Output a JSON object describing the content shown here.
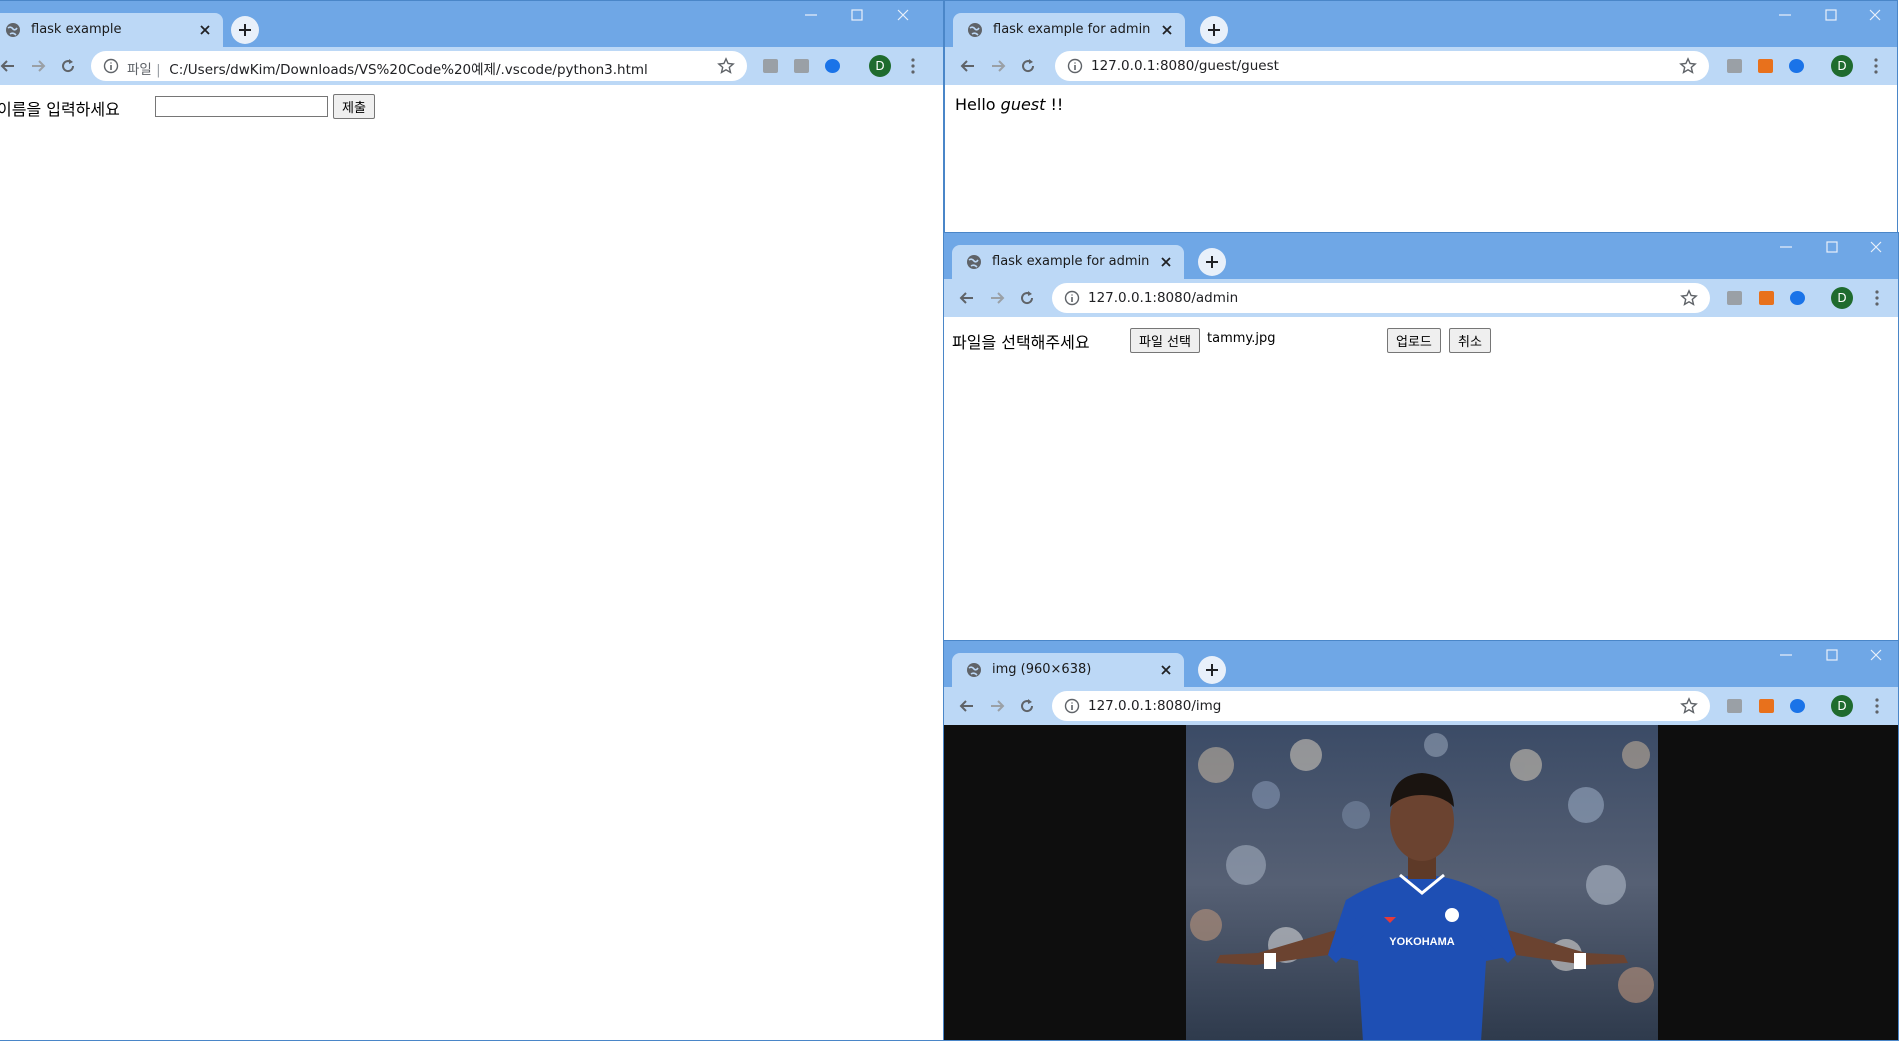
{
  "windows": {
    "left": {
      "tab_title": "flask example",
      "address_prefix": "파일",
      "address": "C:/Users/dwKim/Downloads/VS%20Code%20예제/.vscode/python3.html",
      "avatar_letter": "D",
      "page": {
        "name_label": "이름을 입력하세요",
        "name_input_value": "",
        "submit_label": "제출"
      }
    },
    "guest": {
      "tab_title": "flask example for admin",
      "address": "127.0.0.1:8080/guest/guest",
      "avatar_letter": "D",
      "page": {
        "hello": "Hello",
        "name": "guest",
        "suffix": "!!"
      }
    },
    "admin": {
      "tab_title": "flask example for admin",
      "address": "127.0.0.1:8080/admin",
      "avatar_letter": "D",
      "page": {
        "file_label": "파일을 선택해주세요",
        "choose_file_label": "파일 선택",
        "file_name": "tammy.jpg",
        "upload_label": "업로드",
        "cancel_label": "취소"
      }
    },
    "img": {
      "tab_title": "img (960×638)",
      "address": "127.0.0.1:8080/img",
      "avatar_letter": "D",
      "page": {
        "jersey_text": "YOKOHAMA"
      }
    }
  },
  "colors": {
    "title_bar": "#6fa7e6",
    "toolbar": "#bcd8f6",
    "image_viewer_bg": "#0e0e0e",
    "jersey": "#1e4fb4"
  },
  "icons": [
    "globe-icon",
    "close-icon",
    "new-tab-icon",
    "minimize-icon",
    "maximize-icon",
    "window-close-icon",
    "back-icon",
    "forward-icon",
    "reload-icon",
    "info-icon",
    "star-icon",
    "extension-icon",
    "menu-icon"
  ]
}
